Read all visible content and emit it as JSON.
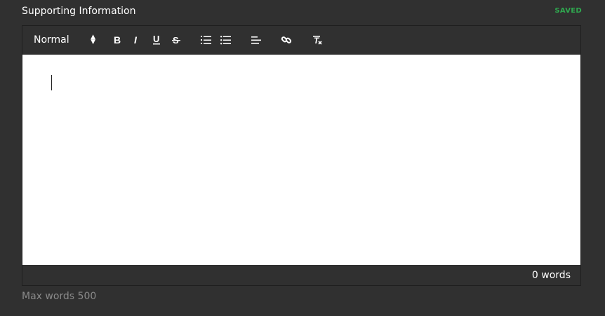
{
  "field": {
    "label": "Supporting Information",
    "status": "SAVED",
    "status_color": "#2fa84f"
  },
  "toolbar": {
    "format_value": "Normal",
    "buttons": [
      {
        "name": "bold-icon",
        "glyph": "B"
      },
      {
        "name": "italic-icon",
        "glyph": "I"
      },
      {
        "name": "underline-icon",
        "glyph": "U"
      },
      {
        "name": "strikethrough-icon",
        "glyph": "S"
      },
      {
        "name": "ordered-list-icon"
      },
      {
        "name": "bullet-list-icon"
      },
      {
        "name": "align-left-icon"
      },
      {
        "name": "link-icon"
      },
      {
        "name": "clear-format-icon"
      }
    ]
  },
  "editor": {
    "content": "",
    "word_count": "0 words"
  },
  "hint": "Max words 500"
}
